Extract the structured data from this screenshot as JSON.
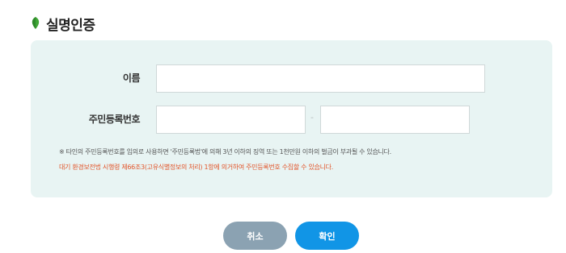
{
  "header": {
    "title": "실명인증",
    "icon": "leaf-icon",
    "icon_color": "#3fa535"
  },
  "form": {
    "name_label": "이름",
    "name_value": "",
    "rrn_label": "주민등록번호",
    "rrn_front_value": "",
    "rrn_back_value": "",
    "rrn_separator": "-"
  },
  "notice": {
    "warning": "※ 타인의 주민등록번호를 임의로 사용하면 '주민등록법'에 의해 3년 이하의 징역 또는 1천만원 이하의 벌금이 부과될 수 있습니다.",
    "legal": "대기 환경보전법 시행령 제66조3(고유식별정보의 처리) 1항에 의거하여 주민등록번호 수집할 수 있습니다."
  },
  "buttons": {
    "cancel_label": "취소",
    "confirm_label": "확인"
  },
  "colors": {
    "panel_bg": "#e8f4f3",
    "cancel_bg": "#8ba2b2",
    "confirm_bg": "#1195e6",
    "legal_text": "#e2552a"
  }
}
